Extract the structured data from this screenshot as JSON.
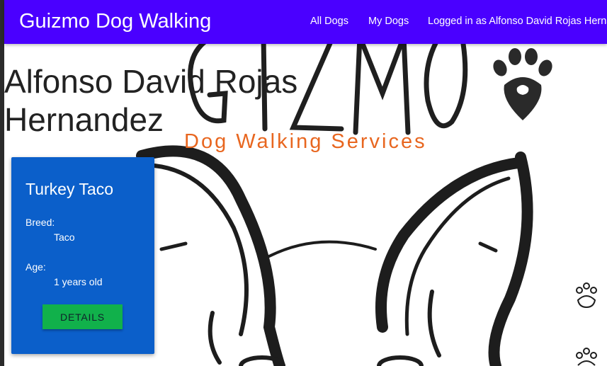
{
  "navbar": {
    "brand": "Guizmo Dog Walking",
    "links": {
      "all_dogs": "All Dogs",
      "my_dogs": "My Dogs",
      "logged_in": "Logged in as Alfonso David Rojas Hernandez"
    },
    "color": "#4a00ff"
  },
  "background": {
    "logo_text": "GIZMO",
    "tagline": "Dog Walking Services",
    "tagline_color": "#e8661f",
    "icons": [
      "paw-location-pin-icon",
      "paw-print-icon",
      "paw-print-icon",
      "french-bulldog-illustration"
    ]
  },
  "page": {
    "title": "Alfonso David Rojas Hernandez"
  },
  "dog_card": {
    "name": "Turkey Taco",
    "breed_label": "Breed:",
    "breed_value": "Taco",
    "age_label": "Age:",
    "age_value": "1 years old",
    "details_label": "DETAILS",
    "card_color": "#0b5fca",
    "button_color": "#11b14b"
  }
}
